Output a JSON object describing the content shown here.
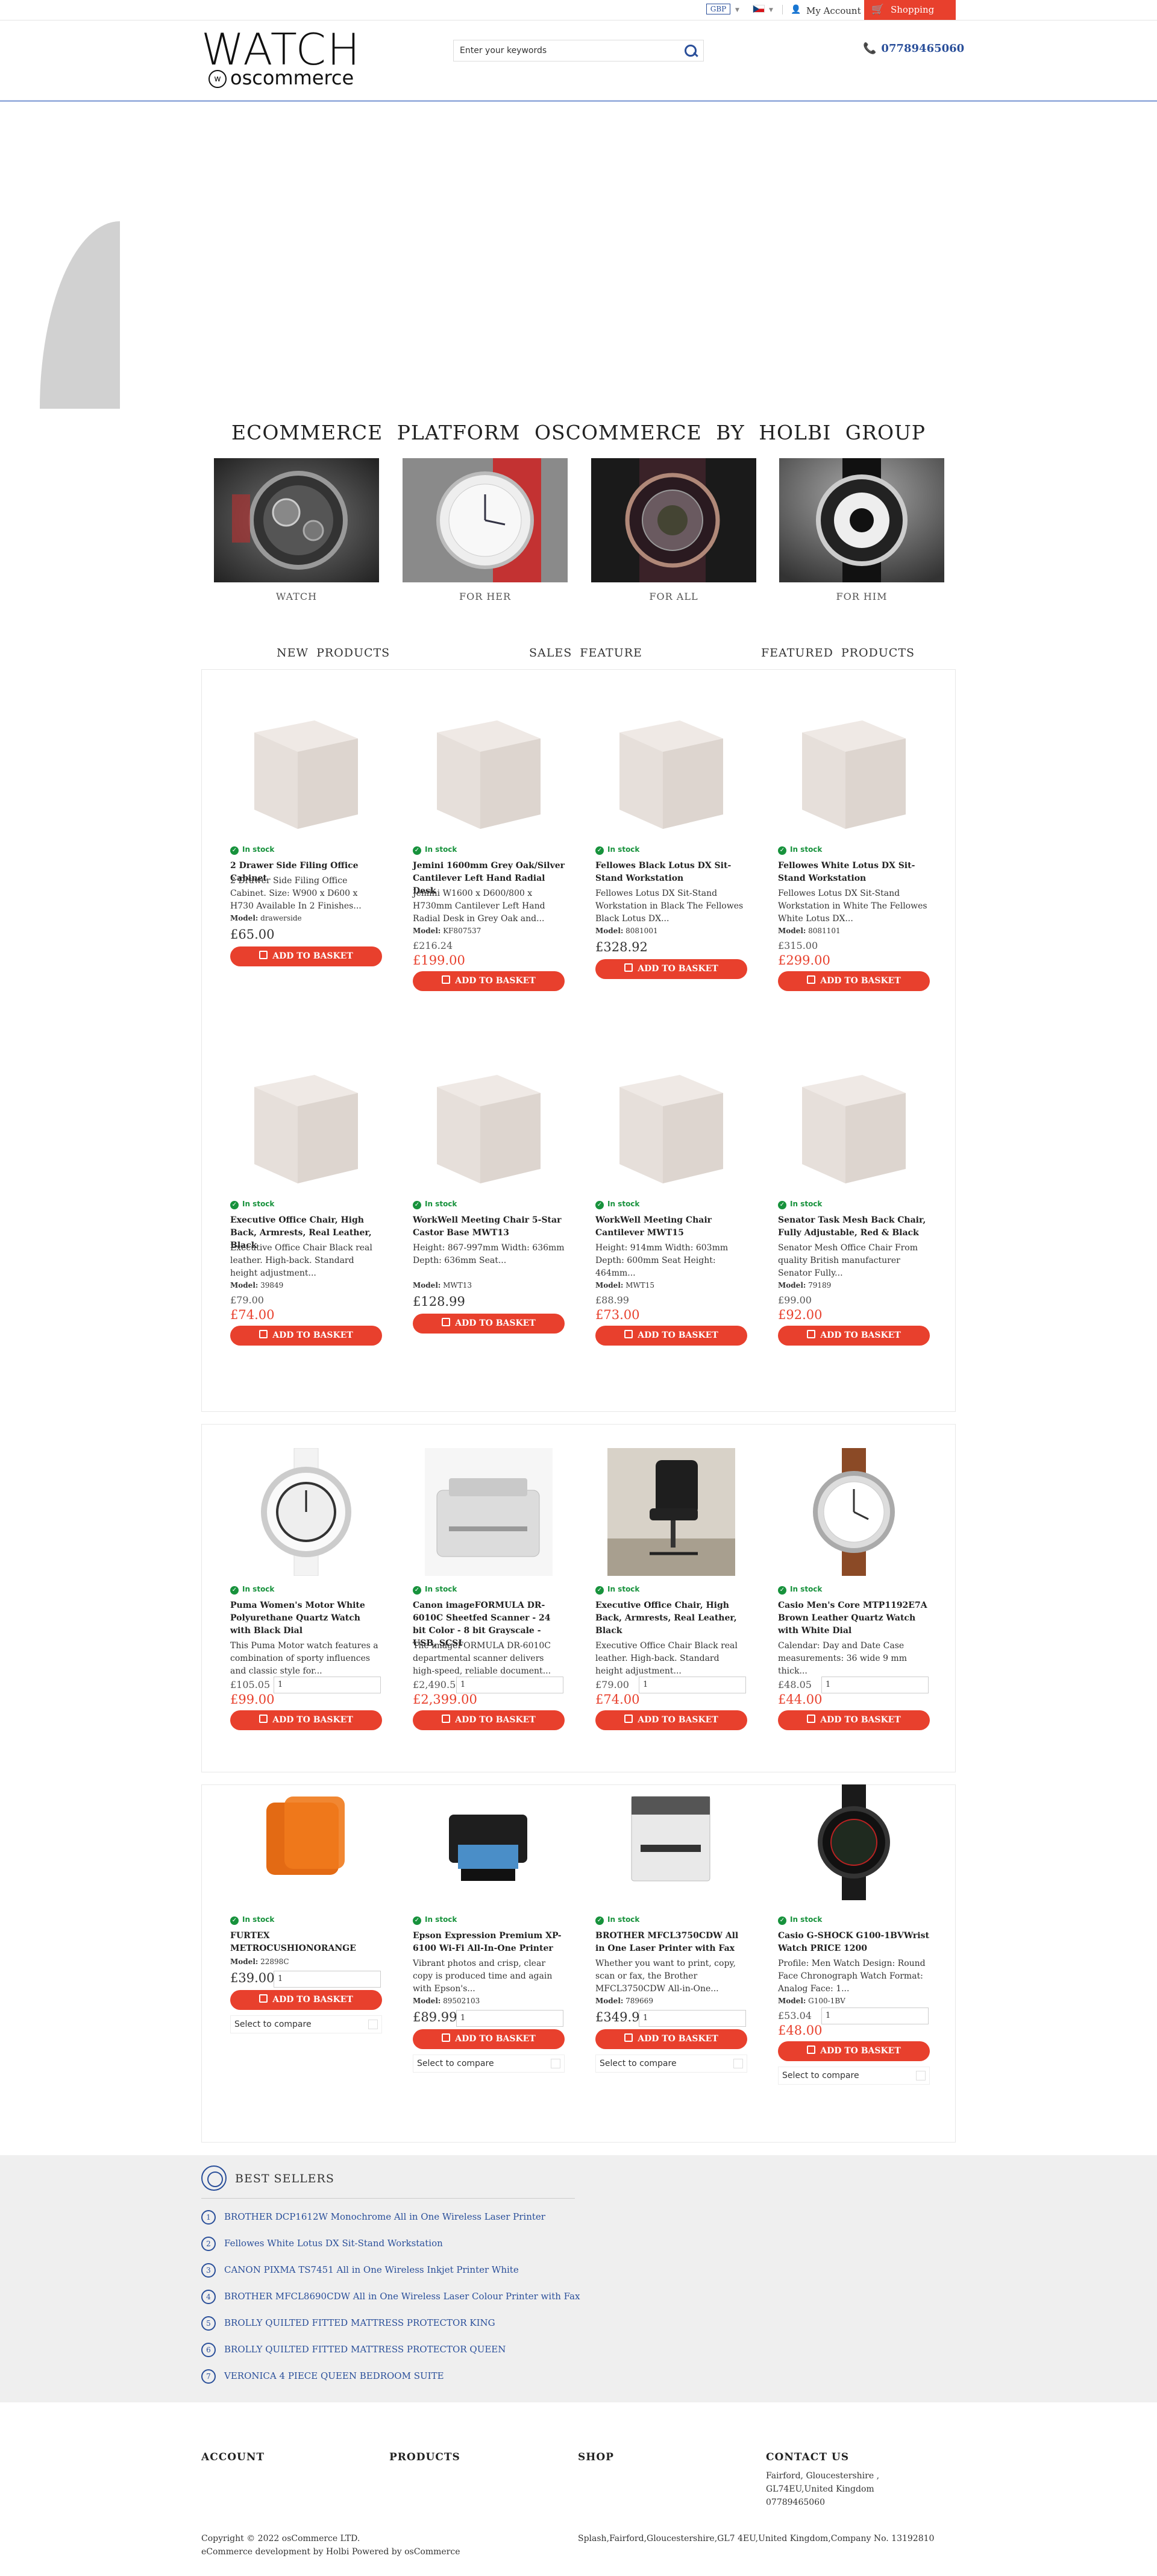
{
  "topbar": {
    "currency": "GBP",
    "account": "My Account",
    "cart": "Shopping Cart"
  },
  "header": {
    "logo_main": "WATCH",
    "logo_sub": "oscommerce",
    "search_placeholder": "Enter your keywords",
    "phone": "07789465060"
  },
  "tagline": "ECOMMERCE PLATFORM OSCOMMERCE BY HOLBI GROUP",
  "categories": [
    "WATCH",
    "FOR HER",
    "FOR ALL",
    "FOR HIM"
  ],
  "tabs": [
    "NEW PRODUCTS",
    "SALES FEATURE",
    "FEATURED PRODUCTS"
  ],
  "stock_label": "In stock",
  "button_label": "ADD TO BASKET",
  "model_label": "Model:",
  "compare_label": "Select to compare",
  "new_products": [
    {
      "name": "2 Drawer Side Filing Office Cabinet",
      "desc": "2 Drawer Side Filing Office Cabinet. Size: W900 x D600 x H730 Available In 2 Finishes...",
      "model": "drawerside",
      "price": "£65.00"
    },
    {
      "name": "Jemini 1600mm Grey Oak/Silver Cantilever Left Hand Radial Desk",
      "desc": "Jemini W1600 x D600/800 x H730mm Cantilever Left Hand Radial Desk in Grey Oak and...",
      "model": "KF807537",
      "old": "£216.24",
      "price": "£199.00"
    },
    {
      "name": "Fellowes Black Lotus DX Sit-Stand Workstation",
      "desc": "Fellowes Lotus DX Sit-Stand Workstation in Black The Fellowes Black Lotus DX...",
      "model": "8081001",
      "price": "£328.92"
    },
    {
      "name": "Fellowes White Lotus DX Sit-Stand Workstation",
      "desc": "Fellowes Lotus DX Sit-Stand Workstation in White The Fellowes White Lotus DX...",
      "model": "8081101",
      "old": "£315.00",
      "price": "£299.00"
    },
    {
      "name": "Executive Office Chair, High Back, Armrests, Real Leather, Black",
      "desc": "Executive Office Chair Black real leather. High-back. Standard height adjustment...",
      "model": "39849",
      "old": "£79.00",
      "price": "£74.00"
    },
    {
      "name": "WorkWell Meeting Chair 5-Star Castor Base MWT13",
      "desc": "Height: 867-997mm Width: 636mm Depth: 636mm Seat...",
      "model": "MWT13",
      "price": "£128.99"
    },
    {
      "name": "WorkWell Meeting Chair Cantilever MWT15",
      "desc": "Height: 914mm Width: 603mm Depth: 600mm Seat Height: 464mm...",
      "model": "MWT15",
      "old": "£88.99",
      "price": "£73.00"
    },
    {
      "name": "Senator Task Mesh Back Chair, Fully Adjustable, Red & Black",
      "desc": "Senator Mesh Office Chair From quality British manufacturer Senator Fully...",
      "model": "79189",
      "old": "£99.00",
      "price": "£92.00"
    }
  ],
  "sale_products": [
    {
      "name": "Puma Women's Motor White Polyurethane Quartz Watch with Black Dial",
      "desc": "This Puma Motor watch features a combination of sporty influences and classic style for...",
      "old": "£105.05",
      "price": "£99.00",
      "qty": "1"
    },
    {
      "name": "Canon imageFORMULA DR-6010C Sheetfed Scanner - 24 bit Color - 8 bit Grayscale - USB, SCSI",
      "desc": "The imageFORMULA DR-6010C departmental scanner delivers high-speed, reliable document...",
      "old": "£2,490.5",
      "price": "£2,399.00",
      "qty": "1"
    },
    {
      "name": "Executive Office Chair, High Back, Armrests, Real Leather, Black",
      "desc": "Executive Office Chair Black real leather. High-back. Standard height adjustment...",
      "old": "£79.00",
      "price": "£74.00",
      "qty": "1"
    },
    {
      "name": "Casio Men's Core MTP1192E7A Brown Leather Quartz Watch with White Dial",
      "desc": "Calendar: Day and Date Case measurements: 36 wide 9 mm thick...",
      "old": "£48.05",
      "price": "£44.00",
      "qty": "1"
    }
  ],
  "featured_products": [
    {
      "name": "FURTEX METROCUSHIONORANGE",
      "model": "22898C",
      "price": "£39.00",
      "qty": "1"
    },
    {
      "name": "Epson Expression Premium XP-6100 Wi-Fi All-In-One Printer",
      "desc": "Vibrant photos and crisp, clear copy is produced time and again with Epson's...",
      "model": "89502103",
      "price": "£89.99",
      "qty": "1"
    },
    {
      "name": "BROTHER MFCL3750CDW All in One Laser Printer with Fax",
      "desc": "Whether you want to print, copy, scan or fax, the Brother MFCL3750CDW All-in-One...",
      "model": "789669",
      "price": "£349.99",
      "qty": "1"
    },
    {
      "name": "Casio G-SHOCK G100-1BVWrist Watch PRICE 1200",
      "desc": "Profile: Men Watch Design: Round Face Chronograph Watch Format: Analog Face: 1...",
      "model": "G100-1BV",
      "old": "£53.04",
      "price": "£48.00",
      "qty": "1"
    }
  ],
  "bestsellers": {
    "title": "BEST SELLERS",
    "items": [
      "BROTHER DCP1612W Monochrome All in One Wireless Laser Printer",
      "Fellowes White Lotus DX Sit-Stand Workstation",
      "CANON PIXMA TS7451 All in One Wireless Inkjet Printer White",
      "BROTHER MFCL8690CDW All in One Wireless Laser Colour Printer with Fax",
      "BROLLY QUILTED FITTED MATTRESS PROTECTOR KING",
      "BROLLY QUILTED FITTED MATTRESS PROTECTOR QUEEN",
      "VERONICA 4 PIECE QUEEN BEDROOM SUITE"
    ]
  },
  "footer": {
    "account": "ACCOUNT",
    "products": "PRODUCTS",
    "shop": "SHOP",
    "contact": "CONTACT US",
    "address": "Fairford, Gloucestershire , GL74EU,United Kingdom",
    "phone": "07789465060",
    "copyright": "Copyright © 2022 osCommerce LTD.",
    "powered": "eCommerce development by Holbi Powered by osCommerce",
    "company": "Splash,Fairford,Gloucestershire,GL7 4EU,United Kingdom,Company No. 13192810"
  },
  "colors": {
    "accent": "#e8402d",
    "link": "#2a4f9a",
    "stock": "#17923c"
  }
}
